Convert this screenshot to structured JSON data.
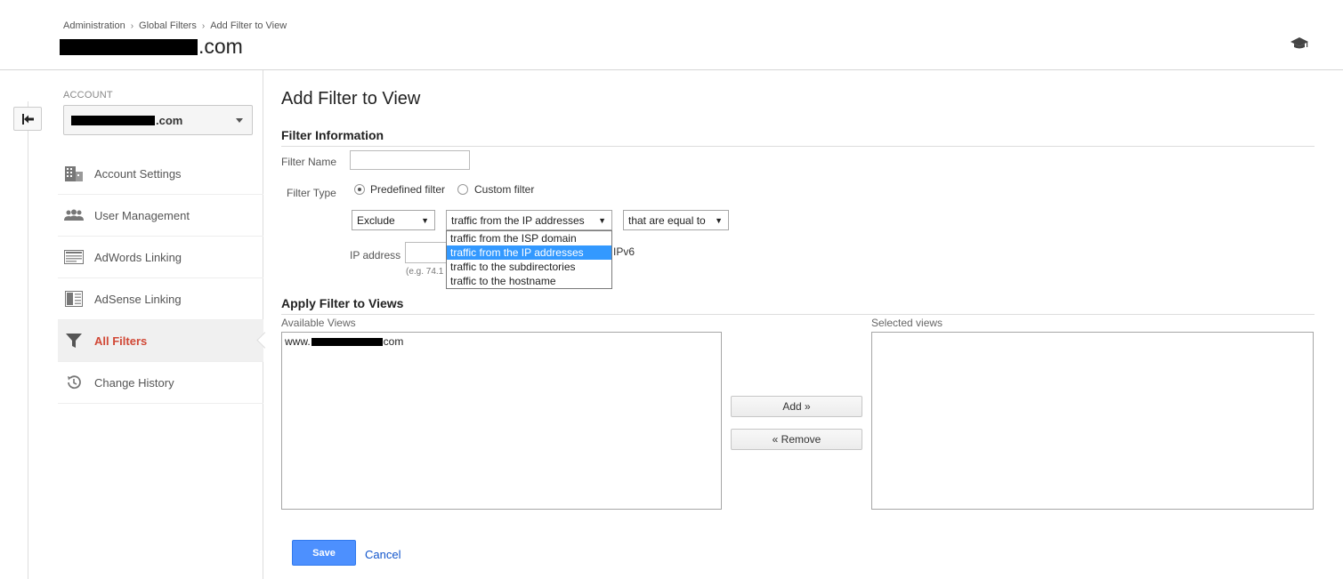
{
  "breadcrumb": {
    "items": [
      "Administration",
      "Global Filters",
      "Add Filter to View"
    ],
    "separator": "›"
  },
  "header": {
    "site_suffix": ".com"
  },
  "sidebar": {
    "account_label": "ACCOUNT",
    "account_suffix": ".com",
    "items": [
      {
        "label": "Account Settings",
        "icon": "building-icon",
        "active": false
      },
      {
        "label": "User Management",
        "icon": "users-icon",
        "active": false
      },
      {
        "label": "AdWords Linking",
        "icon": "adwords-icon",
        "active": false
      },
      {
        "label": "AdSense Linking",
        "icon": "adsense-icon",
        "active": false
      },
      {
        "label": "All Filters",
        "icon": "filter-icon",
        "active": true
      },
      {
        "label": "Change History",
        "icon": "history-icon",
        "active": false
      }
    ]
  },
  "main": {
    "title": "Add Filter to View",
    "filter_info": {
      "section_title": "Filter Information",
      "name_label": "Filter Name",
      "name_value": "",
      "type_label": "Filter Type",
      "predefined_label": "Predefined filter",
      "custom_label": "Custom filter",
      "predefined_selected": true,
      "action_select": "Exclude",
      "source_select": "traffic from the IP addresses",
      "condition_select": "that are equal to",
      "dropdown_options": [
        "traffic from the ISP domain",
        "traffic from the IP addresses",
        "traffic to the subdirectories",
        "traffic to the hostname"
      ],
      "dropdown_selected_index": 1,
      "ip_label": "IP address",
      "ip_value": "",
      "ip_hint": "(e.g. 74.1",
      "ipv6_text": "IPv6"
    },
    "apply": {
      "section_title": "Apply Filter to Views",
      "available_label": "Available Views",
      "selected_label": "Selected views",
      "available_prefix": "www.",
      "available_suffix": "com",
      "add_label": "Add »",
      "remove_label": "« Remove"
    },
    "save_label": "Save",
    "cancel_label": "Cancel"
  },
  "colors": {
    "active_nav": "#d14836",
    "save_button": "#4d90fe",
    "dropdown_highlight": "#3399ff",
    "link": "#1155cc"
  }
}
